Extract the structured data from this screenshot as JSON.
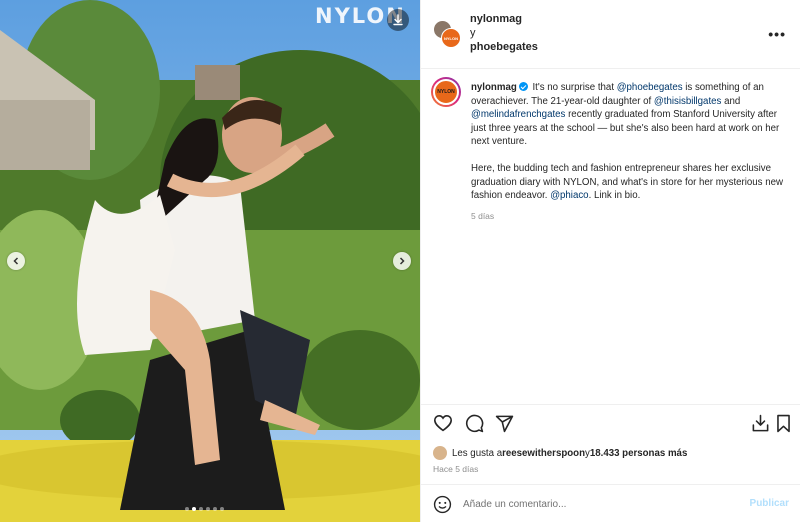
{
  "photo": {
    "watermark": "NYLON",
    "carousel_total": 6,
    "carousel_active": 1
  },
  "header": {
    "author": "nylonmag",
    "connector": "y",
    "coauthor": "phoebegates",
    "more_icon": "more-options-icon"
  },
  "caption": {
    "username": "nylonmag",
    "p1_a": "It's no surprise that ",
    "mention_phoebe": "@phoebegates",
    "p1_b": " is something of an overachiever. The 21-year-old daughter of ",
    "mention_bill": "@thisisbillgates",
    "p1_c": " and ",
    "mention_melinda": "@melindafrenchgates",
    "p1_d": " recently graduated from Stanford University after just three years at the school — but she's also been hard at work on her next venture.",
    "p2_a": "Here, the budding tech and fashion entrepreneur shares her exclusive graduation diary with NYLON, and what's in store for her mysterious new fashion endeavor. ",
    "mention_phiaco": "@phiaco",
    "p2_b": ". Link in bio.",
    "time": "5 días"
  },
  "likes": {
    "prefix": "Les gusta a ",
    "user": "reesewitherspoon",
    "middle": " y ",
    "count": "18.433 personas más"
  },
  "ago": "Hace 5 días",
  "comment": {
    "placeholder": "Añade un comentario...",
    "publish": "Publicar"
  },
  "colors": {
    "accent": "#0095f6",
    "link": "#00376b",
    "brand_orange": "#e8681a",
    "publish_disabled": "#b2dffc"
  }
}
